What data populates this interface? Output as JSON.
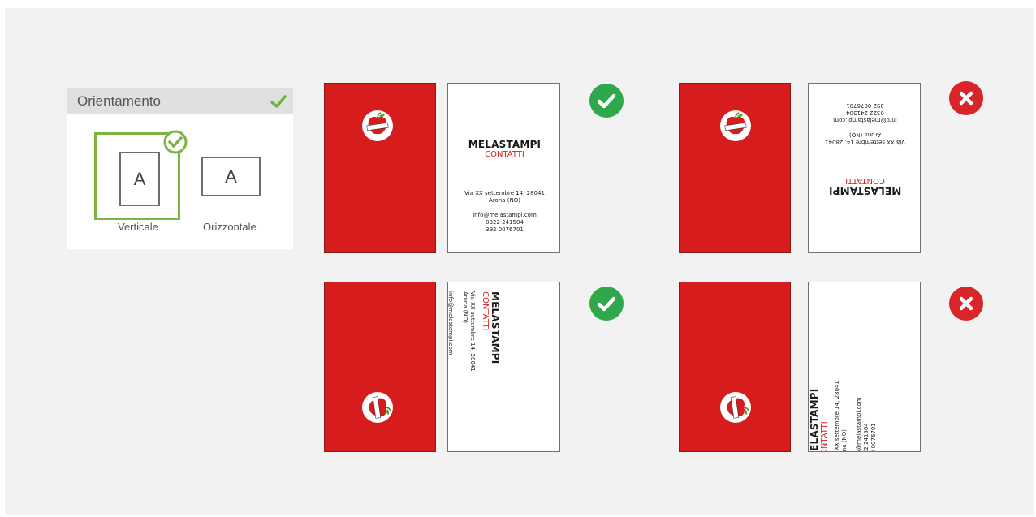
{
  "panel": {
    "title": "Orientamento",
    "options": [
      {
        "label": "Verticale",
        "letter": "A",
        "selected": true
      },
      {
        "label": "Orizzontale",
        "letter": "A",
        "selected": false
      }
    ]
  },
  "card": {
    "brand": "MELASTAMPI",
    "subtitle": "CONTATTI",
    "address_line1": "Via XX settembre 14, 28041",
    "address_line2": "Arona (NO)",
    "email": "info@melastampi.com",
    "phone1": "0322 241504",
    "phone2": "392 0076701",
    "logo_text": "MELASTAMPI"
  },
  "examples": [
    {
      "orientation": "vertical",
      "status": "correct",
      "icon": "check-icon"
    },
    {
      "orientation": "vertical-flipped",
      "status": "wrong",
      "icon": "x-icon"
    },
    {
      "orientation": "rotated-cw",
      "status": "correct",
      "icon": "check-icon"
    },
    {
      "orientation": "rotated-ccw",
      "status": "wrong",
      "icon": "x-icon"
    }
  ],
  "colors": {
    "brand_red": "#d61c1c",
    "ok_green": "#2ea84a",
    "error_red": "#d8252a",
    "selection_green": "#7cb342"
  }
}
